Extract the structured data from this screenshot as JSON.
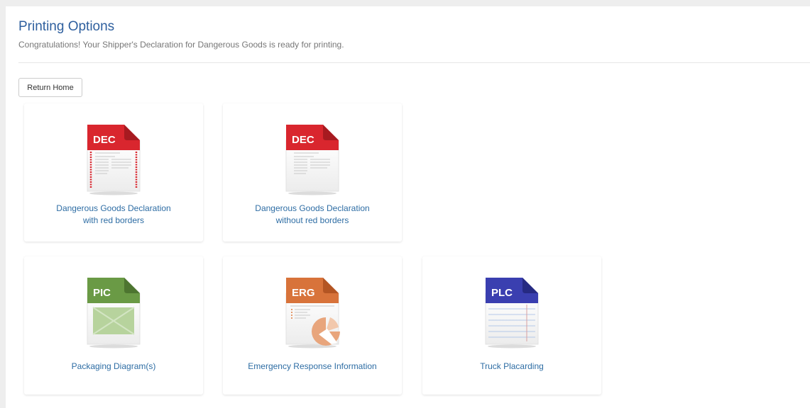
{
  "header": {
    "title": "Printing Options",
    "subtitle": "Congratulations! Your Shipper's Declaration for Dangerous Goods is ready for printing."
  },
  "toolbar": {
    "return_home_label": "Return Home"
  },
  "cards": [
    {
      "badge": "DEC",
      "label_line1": "Dangerous Goods Declaration",
      "label_line2": "with red borders",
      "color": "#d9262e",
      "icon": "document-dec-red-border-icon"
    },
    {
      "badge": "DEC",
      "label_line1": "Dangerous Goods Declaration",
      "label_line2": "without red borders",
      "color": "#d9262e",
      "icon": "document-dec-icon"
    },
    {
      "badge": "PIC",
      "label_line1": "Packaging Diagram(s)",
      "color": "#6a9a45",
      "icon": "document-pic-icon"
    },
    {
      "badge": "ERG",
      "label_line1": "Emergency Response Information",
      "color": "#d8733a",
      "icon": "document-erg-icon"
    },
    {
      "badge": "PLC",
      "label_line1": "Truck Placarding",
      "color": "#3a3fb0",
      "icon": "document-plc-icon"
    }
  ]
}
